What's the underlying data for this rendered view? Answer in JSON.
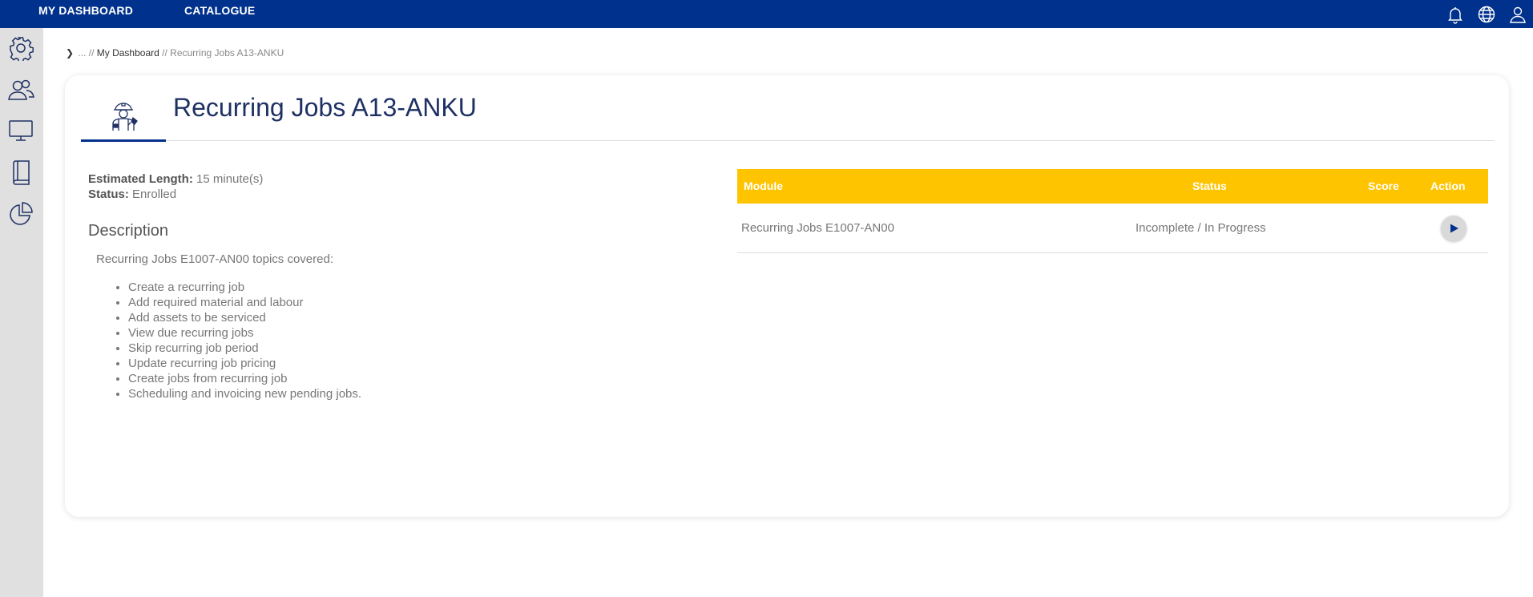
{
  "nav": {
    "items": [
      {
        "label": "MY DASHBOARD"
      },
      {
        "label": "CATALOGUE"
      }
    ],
    "right_icons": [
      "bell-icon",
      "globe-icon",
      "user-icon"
    ]
  },
  "sidebar": {
    "icons": [
      "gear-icon",
      "users-icon",
      "monitor-icon",
      "book-icon",
      "pie-chart-icon"
    ]
  },
  "breadcrumb": {
    "chevron": "❯",
    "ellipsis": "... //",
    "parent": "My Dashboard",
    "separator": "//",
    "current": "Recurring Jobs A13-ANKU"
  },
  "course": {
    "title": "Recurring Jobs A13-ANKU",
    "icon": "worker-icon",
    "estimated_length_label": "Estimated Length:",
    "estimated_length_value": "15 minute(s)",
    "status_label": "Status:",
    "status_value": "Enrolled",
    "description_heading": "Description",
    "description_intro": "Recurring Jobs E1007-AN00 topics covered:",
    "topics": [
      "Create a recurring job",
      "Add required material and labour",
      "Add assets to be serviced",
      "View due recurring jobs",
      "Skip recurring job period",
      "Update recurring job pricing",
      "Create jobs from recurring job",
      "Scheduling and invoicing new pending jobs."
    ]
  },
  "modules_table": {
    "headers": {
      "module": "Module",
      "status": "Status",
      "score": "Score",
      "action": "Action"
    },
    "rows": [
      {
        "module": "Recurring Jobs E1007-AN00",
        "status": "Incomplete / In Progress",
        "score": "",
        "action_icon": "play-icon"
      }
    ]
  },
  "colors": {
    "topbar": "#00318c",
    "table_header": "#ffc400",
    "title": "#1f3164",
    "sidebar": "#e0e0e0"
  }
}
